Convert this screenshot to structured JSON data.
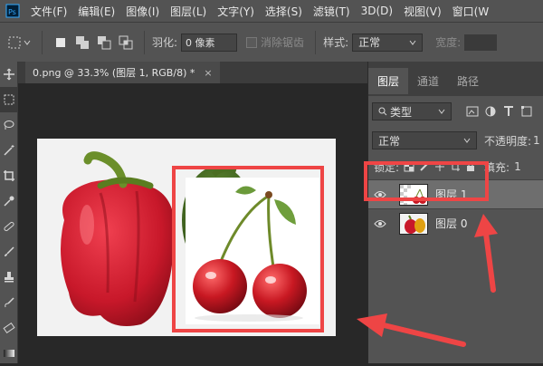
{
  "menu": {
    "items": [
      "文件(F)",
      "编辑(E)",
      "图像(I)",
      "图层(L)",
      "文字(Y)",
      "选择(S)",
      "滤镜(T)",
      "3D(D)",
      "视图(V)",
      "窗口(W"
    ]
  },
  "options": {
    "feather_label": "羽化:",
    "feather_value": "0 像素",
    "antialias_label": "消除锯齿",
    "style_label": "样式:",
    "style_value": "正常",
    "width_label": "宽度:"
  },
  "document": {
    "tab_title": "0.png @ 33.3% (图层 1, RGB/8) *",
    "close_glyph": "×"
  },
  "layers_panel": {
    "tabs": [
      "图层",
      "通道",
      "路径"
    ],
    "filter_kind": "类型",
    "blend_mode": "正常",
    "opacity_label": "不透明度:",
    "opacity_value": "1",
    "lock_label": "锁定:",
    "fill_label": "填充:",
    "fill_value": "1",
    "layers": [
      {
        "name": "图层 1",
        "selected": true,
        "visible": true
      },
      {
        "name": "图层 0",
        "selected": false,
        "visible": true
      }
    ]
  },
  "colors": {
    "annotation_red": "#ee4545",
    "panel_bg": "#535353",
    "canvas_bg": "#282828",
    "pepper_red": "#c8182a",
    "cherry_red": "#b3101c"
  },
  "icons": {
    "eye": "eye-icon",
    "lock": "lock-icon",
    "search": "search-icon"
  }
}
